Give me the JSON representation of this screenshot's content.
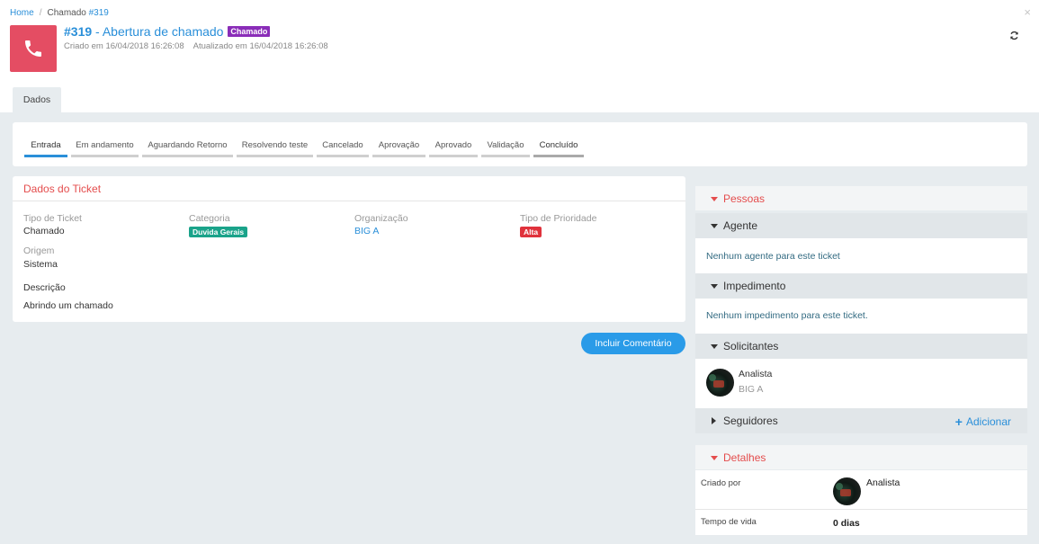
{
  "breadcrumb": {
    "home": "Home",
    "separator": "/",
    "current": "Chamado",
    "current_num": "#319"
  },
  "close_label": "×",
  "ticket": {
    "number": "#319",
    "title_sep": " - ",
    "title": "Abertura de chamado",
    "type_badge": "Chamado",
    "created": "Criado em 16/04/2018 16:26:08",
    "updated": "Atualizado em 16/04/2018 16:26:08",
    "icon": "phone-icon",
    "icon_color": "#e44d63"
  },
  "tabs": [
    {
      "label": "Dados",
      "active": true
    }
  ],
  "status_steps": [
    {
      "label": "Entrada",
      "state": "active"
    },
    {
      "label": "Em andamento",
      "state": ""
    },
    {
      "label": "Aguardando Retorno",
      "state": ""
    },
    {
      "label": "Resolvendo teste",
      "state": ""
    },
    {
      "label": "Cancelado",
      "state": ""
    },
    {
      "label": "Aprovação",
      "state": ""
    },
    {
      "label": "Aprovado",
      "state": ""
    },
    {
      "label": "Validação",
      "state": ""
    },
    {
      "label": "Concluído",
      "state": "last"
    }
  ],
  "ticket_data": {
    "header": "Dados do Ticket",
    "tipo_ticket_label": "Tipo de Ticket",
    "tipo_ticket_value": "Chamado",
    "categoria_label": "Categoria",
    "categoria_value": "Duvida Gerais",
    "organizacao_label": "Organização",
    "organizacao_value": "BIG A",
    "prioridade_label": "Tipo de Prioridade",
    "prioridade_value": "Alta",
    "origem_label": "Origem",
    "origem_value": "Sistema",
    "descricao_label": "Descrição",
    "descricao_value": "Abrindo um chamado"
  },
  "comment_button": "Incluir Comentário",
  "pessoas": {
    "header": "Pessoas",
    "agente_header": "Agente",
    "agente_empty": "Nenhum agente para este ticket",
    "impedimento_header": "Impedimento",
    "impedimento_empty": "Nenhum impedimento para este ticket.",
    "solicitantes_header": "Solicitantes",
    "solicitante_name": "Analista",
    "solicitante_org": "BIG A",
    "seguidores_header": "Seguidores",
    "add_label": "Adicionar"
  },
  "detalhes": {
    "header": "Detalhes",
    "criado_por_label": "Criado por",
    "criado_por_value": "Analista",
    "tempo_vida_label": "Tempo de vida",
    "tempo_vida_value": "0 dias"
  },
  "colors": {
    "accent": "#2a8fd9",
    "danger": "#e44d4d",
    "badge_purple": "#8a2db8",
    "badge_green": "#1aa38a",
    "badge_red": "#e0323c"
  }
}
